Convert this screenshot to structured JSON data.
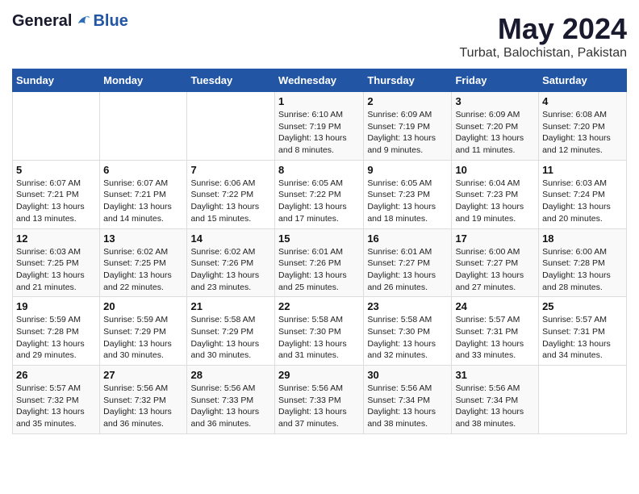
{
  "header": {
    "logo": {
      "general": "General",
      "blue": "Blue"
    },
    "title": "May 2024",
    "location": "Turbat, Balochistan, Pakistan"
  },
  "weekdays": [
    "Sunday",
    "Monday",
    "Tuesday",
    "Wednesday",
    "Thursday",
    "Friday",
    "Saturday"
  ],
  "weeks": [
    [
      {
        "day": "",
        "info": ""
      },
      {
        "day": "",
        "info": ""
      },
      {
        "day": "",
        "info": ""
      },
      {
        "day": "1",
        "info": "Sunrise: 6:10 AM\nSunset: 7:19 PM\nDaylight: 13 hours\nand 8 minutes."
      },
      {
        "day": "2",
        "info": "Sunrise: 6:09 AM\nSunset: 7:19 PM\nDaylight: 13 hours\nand 9 minutes."
      },
      {
        "day": "3",
        "info": "Sunrise: 6:09 AM\nSunset: 7:20 PM\nDaylight: 13 hours\nand 11 minutes."
      },
      {
        "day": "4",
        "info": "Sunrise: 6:08 AM\nSunset: 7:20 PM\nDaylight: 13 hours\nand 12 minutes."
      }
    ],
    [
      {
        "day": "5",
        "info": "Sunrise: 6:07 AM\nSunset: 7:21 PM\nDaylight: 13 hours\nand 13 minutes."
      },
      {
        "day": "6",
        "info": "Sunrise: 6:07 AM\nSunset: 7:21 PM\nDaylight: 13 hours\nand 14 minutes."
      },
      {
        "day": "7",
        "info": "Sunrise: 6:06 AM\nSunset: 7:22 PM\nDaylight: 13 hours\nand 15 minutes."
      },
      {
        "day": "8",
        "info": "Sunrise: 6:05 AM\nSunset: 7:22 PM\nDaylight: 13 hours\nand 17 minutes."
      },
      {
        "day": "9",
        "info": "Sunrise: 6:05 AM\nSunset: 7:23 PM\nDaylight: 13 hours\nand 18 minutes."
      },
      {
        "day": "10",
        "info": "Sunrise: 6:04 AM\nSunset: 7:23 PM\nDaylight: 13 hours\nand 19 minutes."
      },
      {
        "day": "11",
        "info": "Sunrise: 6:03 AM\nSunset: 7:24 PM\nDaylight: 13 hours\nand 20 minutes."
      }
    ],
    [
      {
        "day": "12",
        "info": "Sunrise: 6:03 AM\nSunset: 7:25 PM\nDaylight: 13 hours\nand 21 minutes."
      },
      {
        "day": "13",
        "info": "Sunrise: 6:02 AM\nSunset: 7:25 PM\nDaylight: 13 hours\nand 22 minutes."
      },
      {
        "day": "14",
        "info": "Sunrise: 6:02 AM\nSunset: 7:26 PM\nDaylight: 13 hours\nand 23 minutes."
      },
      {
        "day": "15",
        "info": "Sunrise: 6:01 AM\nSunset: 7:26 PM\nDaylight: 13 hours\nand 25 minutes."
      },
      {
        "day": "16",
        "info": "Sunrise: 6:01 AM\nSunset: 7:27 PM\nDaylight: 13 hours\nand 26 minutes."
      },
      {
        "day": "17",
        "info": "Sunrise: 6:00 AM\nSunset: 7:27 PM\nDaylight: 13 hours\nand 27 minutes."
      },
      {
        "day": "18",
        "info": "Sunrise: 6:00 AM\nSunset: 7:28 PM\nDaylight: 13 hours\nand 28 minutes."
      }
    ],
    [
      {
        "day": "19",
        "info": "Sunrise: 5:59 AM\nSunset: 7:28 PM\nDaylight: 13 hours\nand 29 minutes."
      },
      {
        "day": "20",
        "info": "Sunrise: 5:59 AM\nSunset: 7:29 PM\nDaylight: 13 hours\nand 30 minutes."
      },
      {
        "day": "21",
        "info": "Sunrise: 5:58 AM\nSunset: 7:29 PM\nDaylight: 13 hours\nand 30 minutes."
      },
      {
        "day": "22",
        "info": "Sunrise: 5:58 AM\nSunset: 7:30 PM\nDaylight: 13 hours\nand 31 minutes."
      },
      {
        "day": "23",
        "info": "Sunrise: 5:58 AM\nSunset: 7:30 PM\nDaylight: 13 hours\nand 32 minutes."
      },
      {
        "day": "24",
        "info": "Sunrise: 5:57 AM\nSunset: 7:31 PM\nDaylight: 13 hours\nand 33 minutes."
      },
      {
        "day": "25",
        "info": "Sunrise: 5:57 AM\nSunset: 7:31 PM\nDaylight: 13 hours\nand 34 minutes."
      }
    ],
    [
      {
        "day": "26",
        "info": "Sunrise: 5:57 AM\nSunset: 7:32 PM\nDaylight: 13 hours\nand 35 minutes."
      },
      {
        "day": "27",
        "info": "Sunrise: 5:56 AM\nSunset: 7:32 PM\nDaylight: 13 hours\nand 36 minutes."
      },
      {
        "day": "28",
        "info": "Sunrise: 5:56 AM\nSunset: 7:33 PM\nDaylight: 13 hours\nand 36 minutes."
      },
      {
        "day": "29",
        "info": "Sunrise: 5:56 AM\nSunset: 7:33 PM\nDaylight: 13 hours\nand 37 minutes."
      },
      {
        "day": "30",
        "info": "Sunrise: 5:56 AM\nSunset: 7:34 PM\nDaylight: 13 hours\nand 38 minutes."
      },
      {
        "day": "31",
        "info": "Sunrise: 5:56 AM\nSunset: 7:34 PM\nDaylight: 13 hours\nand 38 minutes."
      },
      {
        "day": "",
        "info": ""
      }
    ]
  ]
}
